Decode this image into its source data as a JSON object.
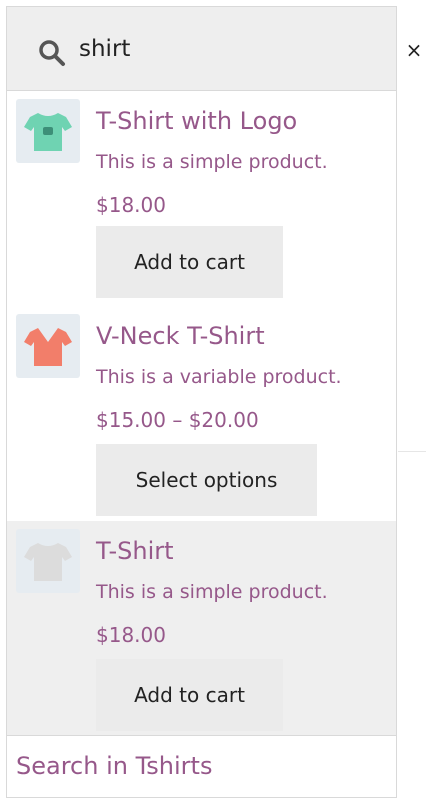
{
  "search": {
    "value": "shirt",
    "close_label": "×"
  },
  "results": [
    {
      "title": "T-Shirt with Logo",
      "description": "This is a simple product.",
      "price": "$18.00",
      "button": "Add to cart",
      "thumb_icon": "tshirt-logo-icon",
      "shirt_color": "#6fd3b2"
    },
    {
      "title": "V-Neck T-Shirt",
      "description": "This is a variable product.",
      "price": "$15.00 – $20.00",
      "button": "Select options",
      "thumb_icon": "vneck-tshirt-icon",
      "shirt_color": "#f27e6a"
    },
    {
      "title": "T-Shirt",
      "description": "This is a simple product.",
      "price": "$18.00",
      "button": "Add to cart",
      "thumb_icon": "tshirt-icon",
      "shirt_color": "#dcdcdc"
    }
  ],
  "footer": {
    "link": "Search in Tshirts"
  },
  "colors": {
    "accent": "#96588a",
    "search_bg": "#eeeeee",
    "button_bg": "#ebebeb",
    "hover_bg": "#efefef"
  }
}
